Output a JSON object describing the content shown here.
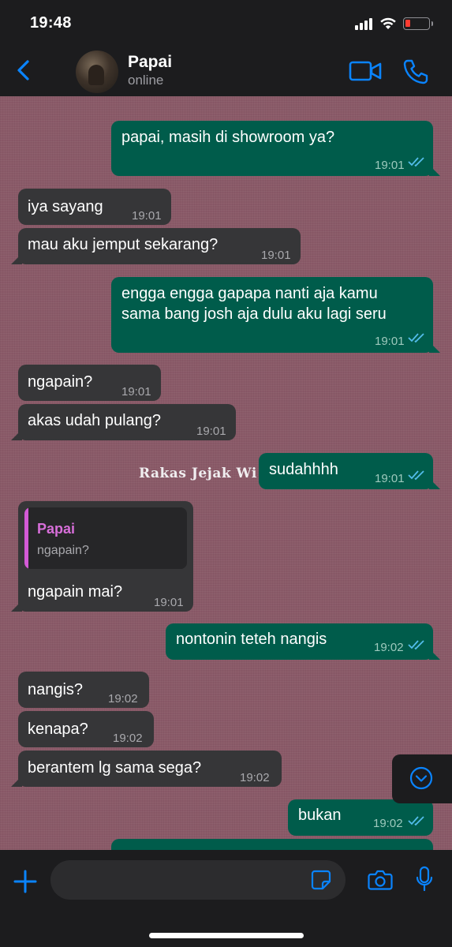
{
  "status_bar": {
    "time": "19:48",
    "battery_color": "#ff3b30"
  },
  "header": {
    "back_icon": "chevron-left-icon",
    "contact_name": "Papai",
    "contact_status": "online",
    "video_icon": "video-call-icon",
    "phone_icon": "voice-call-icon",
    "accent": "#0a84ff"
  },
  "chat": {
    "wallpaper_color": "#8a5a68",
    "watermark": "Rakas Jejak Wi",
    "messages": [
      {
        "dir": "out",
        "text": "papai, masih di showroom ya?",
        "time": "19:01",
        "read": true
      },
      {
        "dir": "in",
        "text": "iya sayang",
        "time": "19:01"
      },
      {
        "dir": "in",
        "text": "mau aku jemput sekarang?",
        "time": "19:01"
      },
      {
        "dir": "out",
        "text_line1": "engga engga gapapa nanti aja kamu",
        "text_line2": "sama bang josh aja dulu aku lagi seru",
        "time": "19:01",
        "read": true
      },
      {
        "dir": "in",
        "text": "ngapain?",
        "time": "19:01"
      },
      {
        "dir": "in",
        "text": "akas udah pulang?",
        "time": "19:01"
      },
      {
        "dir": "out",
        "text": "sudahhhh",
        "time": "19:01",
        "read": true
      },
      {
        "dir": "in",
        "reply_to_name": "Papai",
        "reply_to_text": "ngapain?",
        "text": "ngapain mai?",
        "time": "19:01"
      },
      {
        "dir": "out",
        "text": "nontonin teteh nangis",
        "time": "19:02",
        "read": true
      },
      {
        "dir": "in",
        "text": "nangis?",
        "time": "19:02"
      },
      {
        "dir": "in",
        "text": "kenapa?",
        "time": "19:02"
      },
      {
        "dir": "in",
        "text": "berantem lg sama sega?",
        "time": "19:02"
      },
      {
        "dir": "out",
        "text": "bukan",
        "time": "19:02",
        "read": true
      },
      {
        "dir": "out",
        "text": "",
        "time": "",
        "partial": true
      }
    ]
  },
  "composer": {
    "plus_icon": "plus-icon",
    "sticker_icon": "sticker-icon",
    "camera_icon": "camera-icon",
    "mic_icon": "microphone-icon"
  }
}
